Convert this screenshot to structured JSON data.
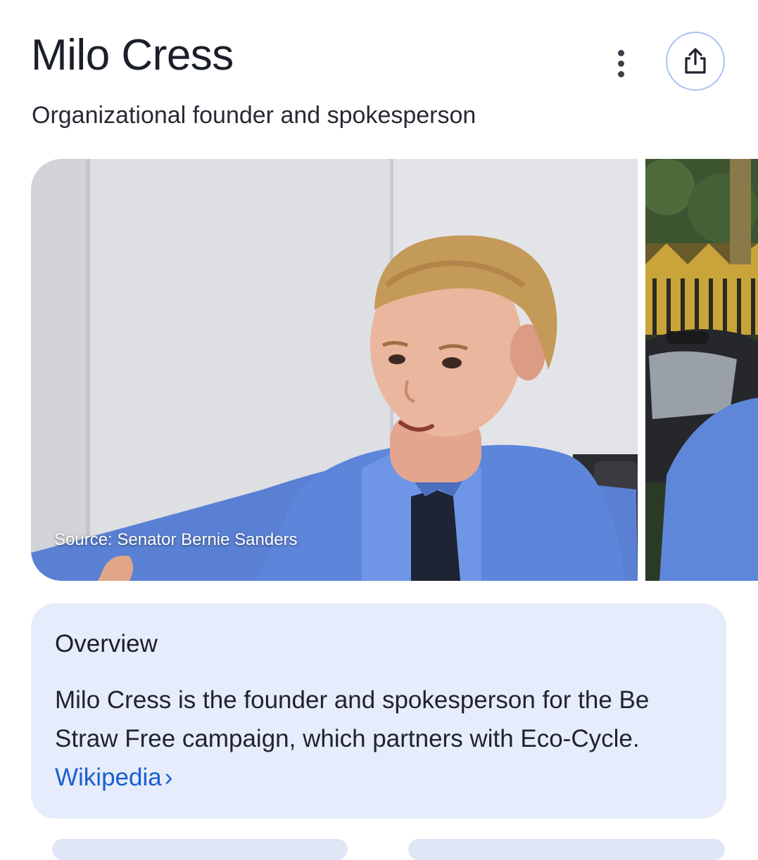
{
  "header": {
    "title": "Milo Cress",
    "subtitle": "Organizational founder and spokesperson",
    "more_icon": "more-vert-icon",
    "share_icon": "share-icon"
  },
  "images": {
    "main_source": "Source: Senator Bernie Sanders"
  },
  "overview": {
    "heading": "Overview",
    "text": "Milo Cress is the founder and spokesperson for the Be Straw Free campaign, which partners with Eco-Cycle.",
    "link_label": "Wikipedia",
    "chevron": "›"
  },
  "colors": {
    "link": "#1a5fd0",
    "overview_bg": "#e6ecfb",
    "share_border": "#a9c3f2"
  }
}
